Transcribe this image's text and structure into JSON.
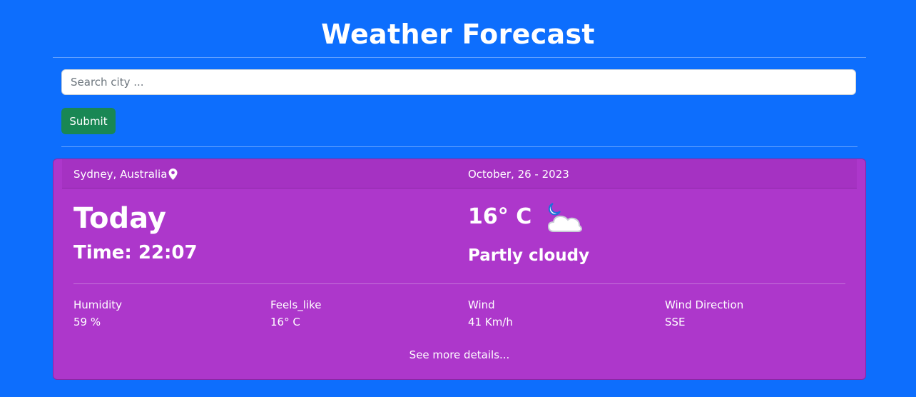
{
  "page": {
    "title": "Weather Forecast"
  },
  "search": {
    "placeholder": "Search city ...",
    "value": "",
    "submit_label": "Submit"
  },
  "card": {
    "location": "Sydney, Australia",
    "date": "October, 26 - 2023",
    "day_label": "Today",
    "time": "Time: 22:07",
    "temperature": "16° C",
    "condition": "Partly cloudy",
    "weather_icon": "partly-cloudy-night-icon",
    "stats": [
      {
        "label": "Humidity",
        "value": "59 %"
      },
      {
        "label": "Feels_like",
        "value": "16° C"
      },
      {
        "label": "Wind",
        "value": "41 Km/h"
      },
      {
        "label": "Wind Direction",
        "value": "SSE"
      }
    ],
    "more_link": "See more details..."
  },
  "colors": {
    "background": "#0d6efd",
    "submit": "#198754",
    "card": "#ad37cb",
    "card_header": "#a532c2"
  }
}
